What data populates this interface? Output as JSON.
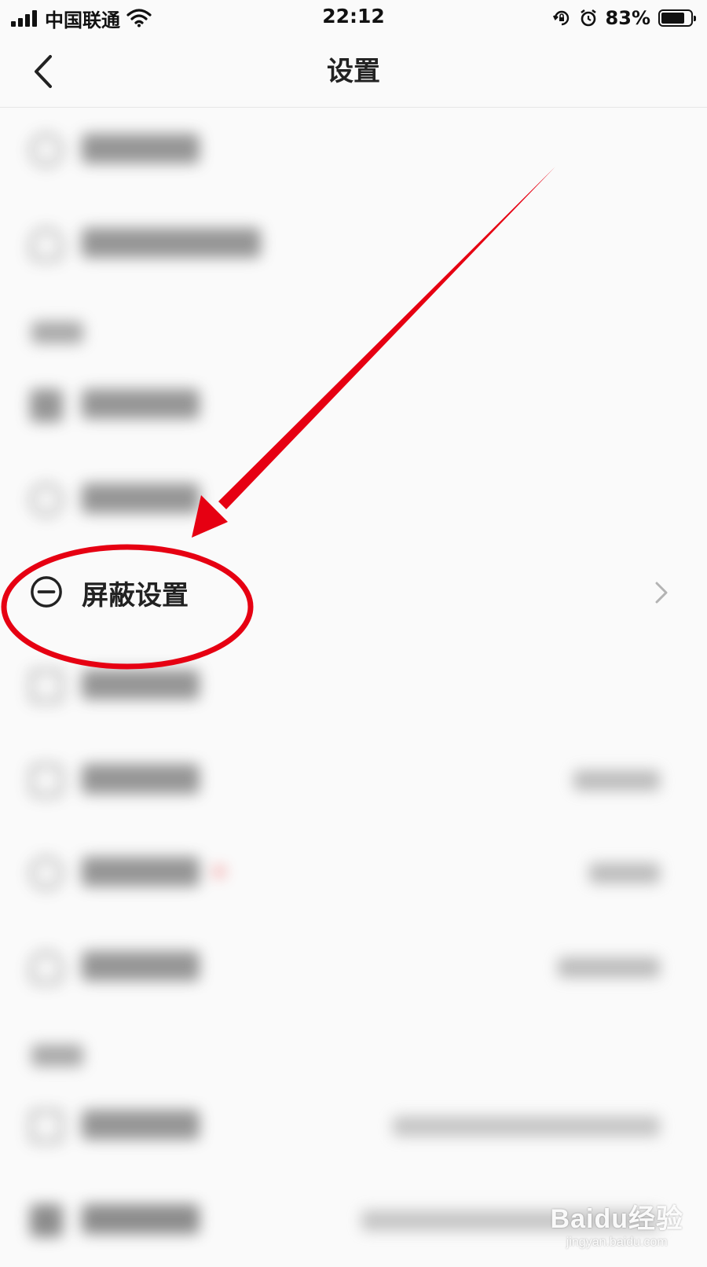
{
  "status_bar": {
    "carrier": "中国联通",
    "time": "22:12",
    "battery_percent": "83%",
    "battery_level": 0.83,
    "icons": [
      "signal-icon",
      "wifi-icon",
      "rotation-lock-icon",
      "alarm-icon",
      "battery-icon"
    ]
  },
  "nav": {
    "title": "设置",
    "back_icon": "chevron-left-icon"
  },
  "list": {
    "highlighted_item": {
      "label": "屏蔽设置",
      "icon": "minus-circle-icon",
      "trailing_icon": "chevron-right-icon"
    }
  },
  "annotation": {
    "arrow_color": "#e60012",
    "circle_color": "#e60012"
  },
  "watermark": {
    "brand": "Baidu经验",
    "url": "jingyan.baidu.com"
  }
}
